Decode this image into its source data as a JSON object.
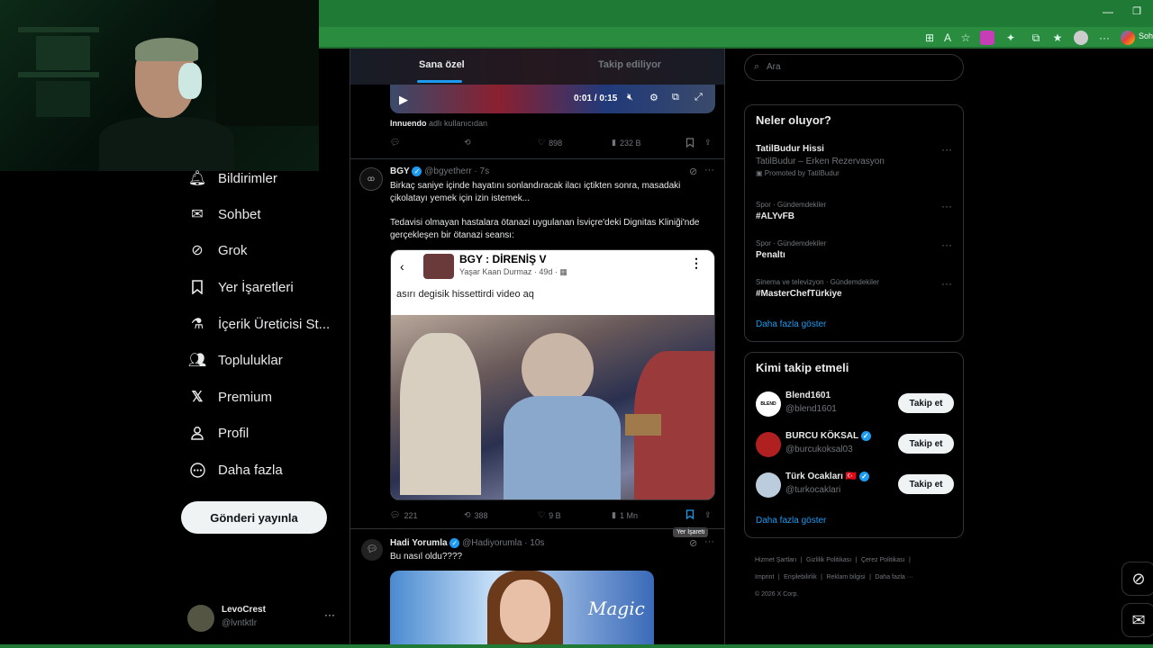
{
  "browser": {
    "minimize": "—",
    "maximize": "❐",
    "copilot_label": "Sohl"
  },
  "nav": {
    "items": [
      {
        "label": "Bildirimler",
        "icon": "bell-icon"
      },
      {
        "label": "Sohbet",
        "icon": "mail-icon"
      },
      {
        "label": "Grok",
        "icon": "grok-icon"
      },
      {
        "label": "Yer İşaretleri",
        "icon": "bookmark-icon"
      },
      {
        "label": "İçerik Üreticisi St...",
        "icon": "flask-icon"
      },
      {
        "label": "Topluluklar",
        "icon": "people-icon"
      },
      {
        "label": "Premium",
        "icon": "x-logo-icon"
      },
      {
        "label": "Profil",
        "icon": "person-icon"
      },
      {
        "label": "Daha fazla",
        "icon": "more-circle-icon"
      }
    ],
    "post_button": "Gönderi yayınla",
    "user": {
      "name": "LevoCrest",
      "handle": "@lvntktlr",
      "more": "···"
    }
  },
  "feed": {
    "tabs": [
      "Sana özel",
      "Takip ediliyor"
    ],
    "prev_post": {
      "video_time": "0:01 / 0:15",
      "credit_name": "Innuendo",
      "credit_rest": " adlı kullanıcıdan",
      "replies": "",
      "reposts": "",
      "likes": "898",
      "views": "232 B"
    },
    "post": {
      "author": "BGY",
      "handle": "@bgyetherr",
      "time": "· 7s",
      "text1": "Birkaç saniye içinde hayatını sonlandıracak ilacı içtikten sonra, masadaki çikolatayı yemek için izin istemek...",
      "text2": "Tedavisi olmayan hastalara ötanazi uygulanan İsviçre'deki Dignitas Kliniği'nde gerçekleşen bir ötanazi seansı:",
      "embed_title": "BGY : DİRENİŞ V",
      "embed_author": "Yaşar Kaan Durmaz",
      "embed_time": "· 49d ·",
      "embed_text": "asırı degisik hissettirdi video aq",
      "replies": "221",
      "reposts": "388",
      "likes": "9 B",
      "views": "1 Mn",
      "tooltip": "Yer İşareti"
    },
    "next_post": {
      "author": "Hadi Yorumla",
      "handle": "@Hadiyorumla",
      "time": "· 10s",
      "text": "Bu nasıl oldu????",
      "overlay": "Magic"
    }
  },
  "right": {
    "search_placeholder": "Ara",
    "trends_title": "Neler oluyor?",
    "trends": [
      {
        "category": "",
        "title": "TatilBudur Hissi",
        "sub": "TatilBudur – Erken Rezervasyon",
        "promo": "Promoted by TatilBudur"
      },
      {
        "category": "Spor · Gündemdekiler",
        "title": "#ALYvFB"
      },
      {
        "category": "Spor · Gündemdekiler",
        "title": "Penaltı"
      },
      {
        "category": "Sinema ve televizyon · Gündemdekiler",
        "title": "#MasterChefTürkiye"
      }
    ],
    "show_more": "Daha fazla göster",
    "who_title": "Kimi takip etmeli",
    "who": [
      {
        "name": "Blend1601",
        "handle": "@blend1601",
        "verified": false,
        "avatar_text": "BLEND"
      },
      {
        "name": "BURCU KÖKSAL",
        "handle": "@burcukoksal03",
        "verified": true,
        "avatar_text": ""
      },
      {
        "name": "Türk Ocakları",
        "handle": "@turkocaklari",
        "verified": true,
        "avatar_text": "",
        "flag": "🇹🇷"
      }
    ],
    "follow_label": "Takip et",
    "who_more": "Daha fazla göster",
    "footer": [
      "Hizmet Şartları",
      "Gizlilik Politikası",
      "Çerez Politikası",
      "Imprint",
      "Erişilebilirlik",
      "Reklam bilgisi",
      "Daha fazla ···",
      "© 2026 X Corp."
    ]
  },
  "colors": {
    "accent": "#1d9bf0",
    "browser_green": "#2a8c3e",
    "bg": "#000000"
  }
}
